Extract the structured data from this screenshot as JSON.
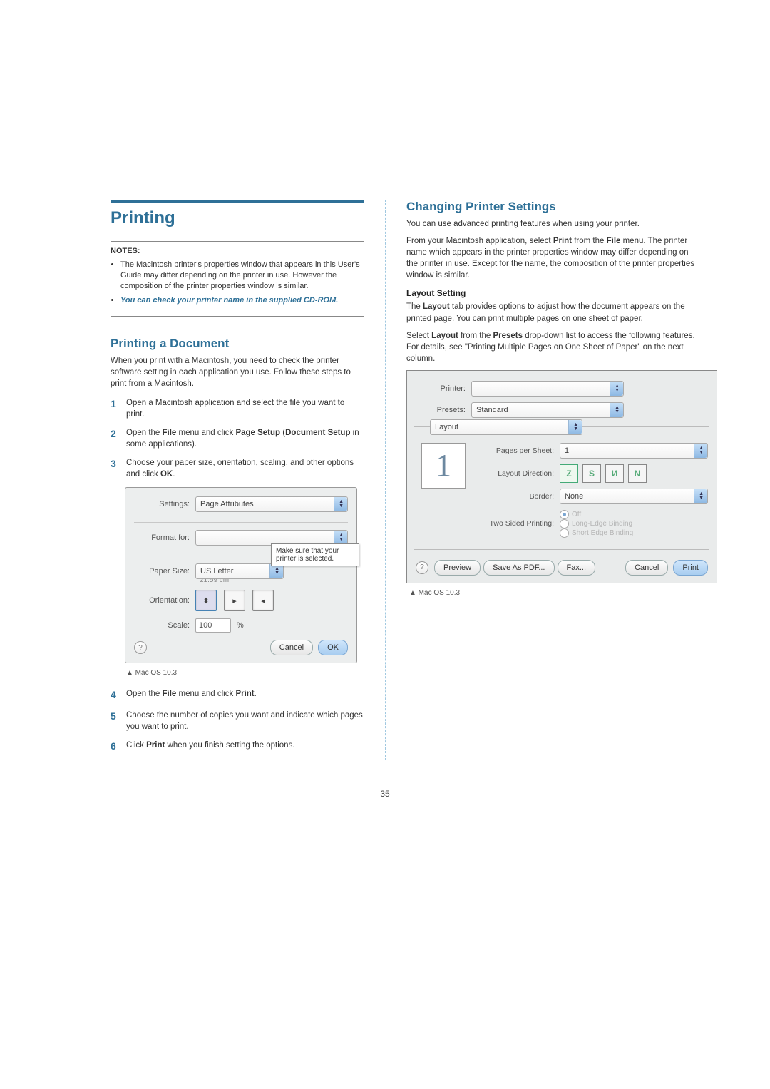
{
  "page_number": "35",
  "left": {
    "title": "Printing",
    "notes_label": "NOTES:",
    "note1": "The Macintosh printer's properties window that appears in this User's Guide may differ depending on the printer in use. However the composition of the printer properties window is similar.",
    "note2": "You can check your printer name in the supplied CD-ROM.",
    "sub1_title": "Printing a Document",
    "sub1_intro": "When you print with a Macintosh, you need to check the printer software setting in each application you use. Follow these steps to print from a Macintosh.",
    "step1": "Open a Macintosh application and select the file you want to print.",
    "step2_pre": "Open the ",
    "step2_bold1": "File",
    "step2_mid": " menu and click ",
    "step2_bold2": "Page Setup",
    "step2_paren": " (",
    "step2_bold3": "Document Setup",
    "step2_post": " in some applications).",
    "step3_pre": "Choose your paper size, orientation, scaling, and other options and click ",
    "step3_bold": "OK",
    "step3_post": ".",
    "dialog1": {
      "settings_label": "Settings:",
      "settings_value": "Page Attributes",
      "format_for_label": "Format for:",
      "format_for_value": "",
      "paper_size_label": "Paper Size:",
      "paper_size_value": "US Letter",
      "paper_size_dim": "21.59 cm",
      "orientation_label": "Orientation:",
      "scale_label": "Scale:",
      "scale_value": "100",
      "scale_unit": "%",
      "callout": "Make sure that your printer is selected.",
      "cancel": "Cancel",
      "ok": "OK"
    },
    "caption1": "▲ Mac OS 10.3",
    "step4_pre": "Open the ",
    "step4_bold1": "File",
    "step4_mid": " menu and click ",
    "step4_bold2": "Print",
    "step4_post": ".",
    "step5": "Choose the number of copies you want and indicate which pages you want to print.",
    "step6_pre": "Click ",
    "step6_bold": "Print",
    "step6_post": " when you finish setting the options."
  },
  "right": {
    "title": "Changing Printer Settings",
    "p1": "You can use advanced printing features when using your printer.",
    "p2_pre": "From your Macintosh application, select ",
    "p2_b1": "Print",
    "p2_mid": " from the ",
    "p2_b2": "File",
    "p2_post": " menu. The printer name which appears in the printer properties window may differ depending on the printer in use. Except for the name, the composition of the printer properties window is similar.",
    "h3": "Layout Setting",
    "p3_pre": "The ",
    "p3_b1": "Layout",
    "p3_post": " tab provides options to adjust how the document appears on the printed page. You can print multiple pages on one sheet of paper.",
    "p4_pre": "Select ",
    "p4_b1": "Layout",
    "p4_mid": " from the ",
    "p4_b2": "Presets",
    "p4_post": " drop-down list to access the following features. For details, see \"Printing Multiple Pages on One Sheet of Paper\" on the next column.",
    "dialog2": {
      "printer_label": "Printer:",
      "printer_value": "",
      "presets_label": "Presets:",
      "presets_value": "Standard",
      "section_value": "Layout",
      "pages_per_sheet_label": "Pages per Sheet:",
      "pages_per_sheet_value": "1",
      "layout_direction_label": "Layout Direction:",
      "border_label": "Border:",
      "border_value": "None",
      "two_sided_label": "Two Sided Printing:",
      "radio_off": "Off",
      "radio_long": "Long-Edge Binding",
      "radio_short": "Short Edge Binding",
      "preview": "Preview",
      "save_pdf": "Save As PDF...",
      "fax": "Fax...",
      "cancel": "Cancel",
      "print": "Print"
    },
    "caption2": "▲ Mac OS 10.3"
  }
}
